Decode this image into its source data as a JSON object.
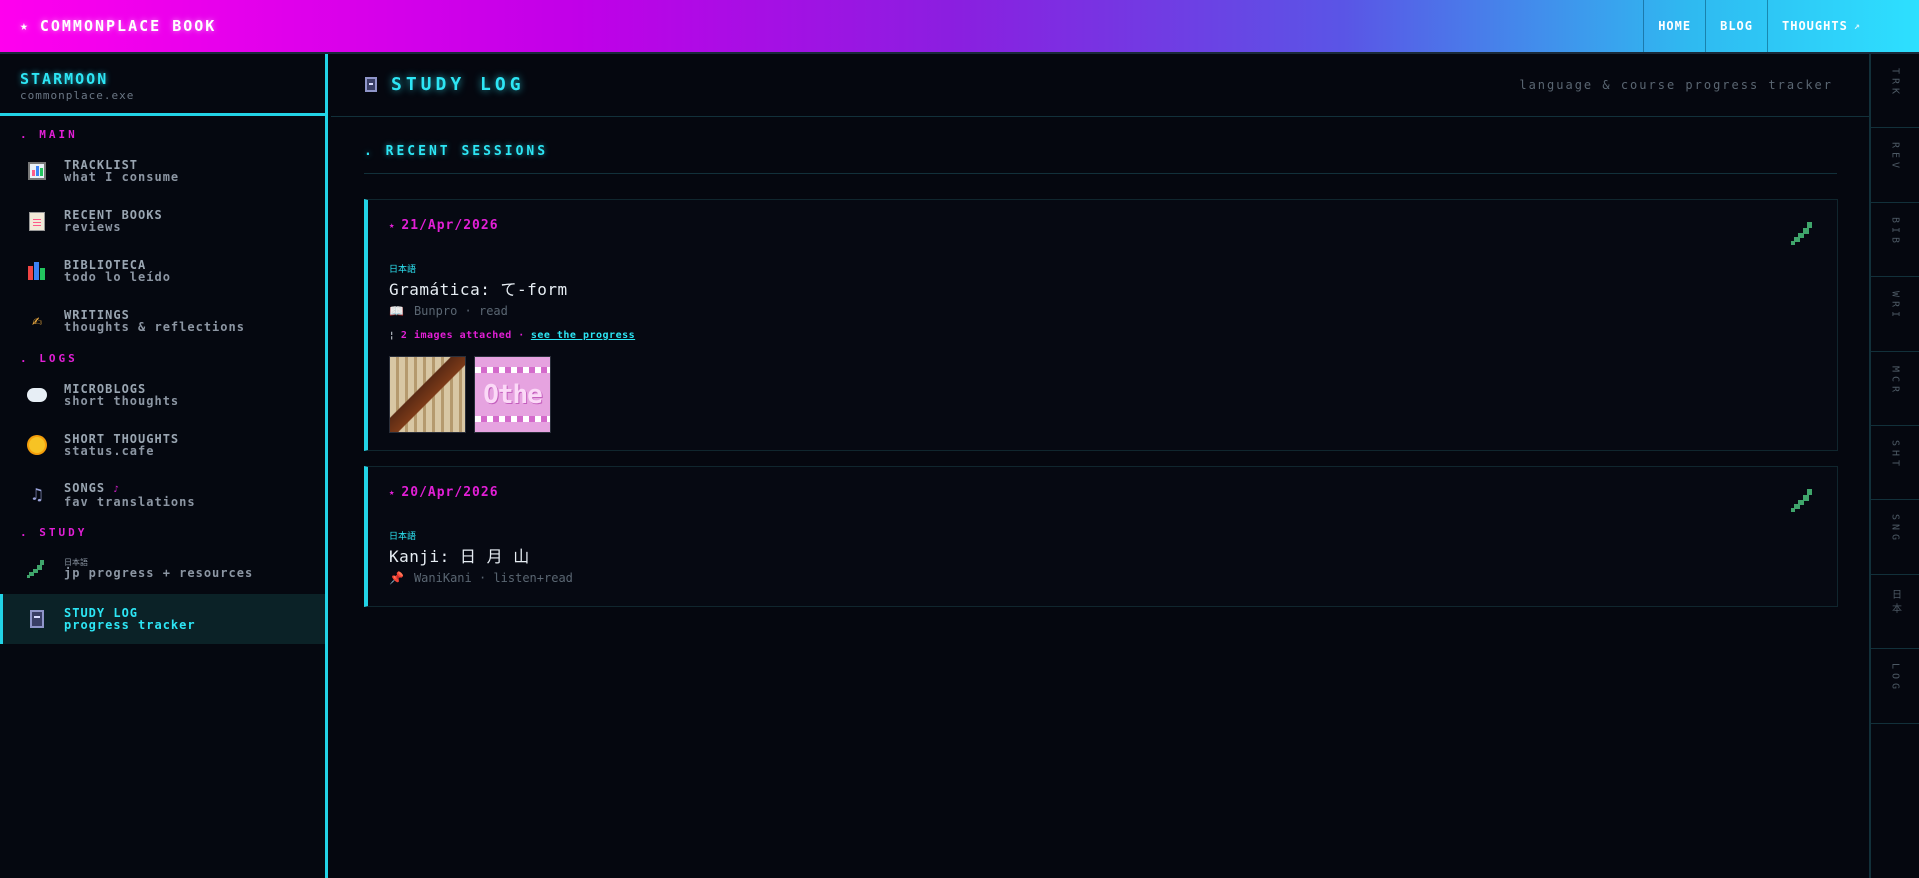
{
  "topbar": {
    "brand": "COMMONPLACE BOOK",
    "brand_icon": "star-icon",
    "nav": [
      "HOME",
      "BLOG",
      "THOUGHTS"
    ],
    "nav_ext_icon": "external-arrow-icon"
  },
  "sidebar": {
    "title": "STARMOON",
    "subtitle": "commonplace.exe",
    "sections": {
      "main": ". MAIN",
      "logs": ". LOGS",
      "study": ". STUDY"
    },
    "items": [
      {
        "icon": "bar-chart-icon",
        "title": "TRACKLIST",
        "sub": "what I consume"
      },
      {
        "icon": "document-icon",
        "title": "RECENT BOOKS",
        "sub": "reviews"
      },
      {
        "icon": "books-icon",
        "title": "BIBLIOTECA",
        "sub": "todo lo leído"
      },
      {
        "icon": "writing-hand-icon",
        "title": "WRITINGS",
        "sub": "thoughts & reflections"
      },
      {
        "icon": "thought-bubble-icon",
        "title": "MICROBLOGS",
        "sub": "short thoughts"
      },
      {
        "icon": "sun-icon",
        "title": "SHORT THOUGHTS",
        "sub": "status.cafe"
      },
      {
        "icon": "music-note-icon",
        "title": "SONGS",
        "sub": "fav translations",
        "title_suffix": "♪"
      },
      {
        "icon": "japan-map-icon",
        "title": "日本語",
        "sub": "jp progress + resources"
      },
      {
        "icon": "notebook-icon",
        "title": "STUDY LOG",
        "sub": "progress tracker",
        "active": true
      }
    ]
  },
  "main": {
    "title": "STUDY LOG",
    "title_icon": "notebook-icon",
    "subtitle": "language & course progress tracker",
    "section": ". RECENT SESSIONS",
    "entries": [
      {
        "date": "21/Apr/2026",
        "lang": "日本語",
        "topic": "Gramática: て-form",
        "meta_icon": "open-book-icon",
        "meta": "Bunpro · read",
        "attach_text": "2 images attached ·",
        "attach_link": "see the progress",
        "thumb2_text": "Othe"
      },
      {
        "date": "20/Apr/2026",
        "lang": "日本語",
        "topic": "Kanji: 日 月 山",
        "meta_icon": "pushpin-icon",
        "meta": "WaniKani · listen+read"
      }
    ]
  },
  "rail": [
    "TRK",
    "REV",
    "BIB",
    "WRI",
    "MCR",
    "SHT",
    "SNG",
    "日本",
    "LOG"
  ],
  "colors": {
    "accent_cyan": "#2de6f5",
    "accent_magenta": "#e21fd6",
    "background": "#05070f"
  }
}
